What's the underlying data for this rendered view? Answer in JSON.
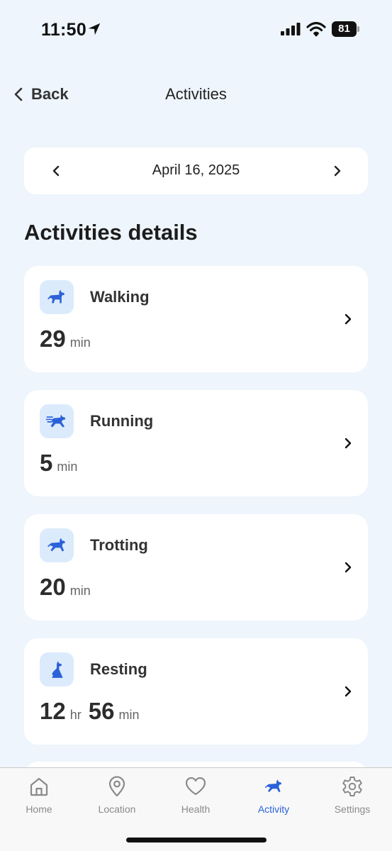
{
  "status": {
    "time": "11:50",
    "battery": "81"
  },
  "nav": {
    "back_label": "Back",
    "title": "Activities"
  },
  "date": {
    "label": "April 16, 2025"
  },
  "section_title": "Activities details",
  "activities": [
    {
      "name": "Walking",
      "icon": "walking-dog-icon",
      "value1": "29",
      "unit1": "min"
    },
    {
      "name": "Running",
      "icon": "running-dog-icon",
      "value1": "5",
      "unit1": "min"
    },
    {
      "name": "Trotting",
      "icon": "trotting-dog-icon",
      "value1": "20",
      "unit1": "min"
    },
    {
      "name": "Resting",
      "icon": "resting-dog-icon",
      "value1": "12",
      "unit1": "hr",
      "value2": "56",
      "unit2": "min"
    }
  ],
  "tabs": [
    {
      "label": "Home",
      "icon": "home-icon"
    },
    {
      "label": "Location",
      "icon": "location-pin-icon"
    },
    {
      "label": "Health",
      "icon": "heart-icon"
    },
    {
      "label": "Activity",
      "icon": "activity-dog-icon",
      "active": true
    },
    {
      "label": "Settings",
      "icon": "gear-icon"
    }
  ],
  "colors": {
    "accent": "#2b62d9",
    "icon_bg": "#dcebfb",
    "background": "#eef5fc"
  }
}
